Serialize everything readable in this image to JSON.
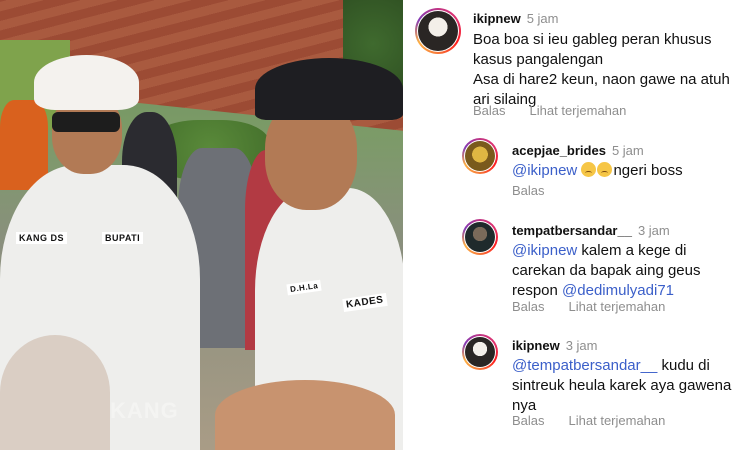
{
  "video": {
    "badges": {
      "left_tag": "KANG DS",
      "right_tag": "BUPATI",
      "kades": "KADES",
      "name_tag": "D.H.La"
    },
    "watermark": "KANG"
  },
  "comments": [
    {
      "username": "ikipnew",
      "time": "5 jam",
      "text_lines": [
        "Boa boa si ieu gableg peran khusus",
        "kasus pangalengan",
        "Asa di hare2 keun, naon gawe na atuh",
        "ari silaing"
      ],
      "actions": {
        "reply": "Balas",
        "translate": "Lihat terjemahan"
      },
      "avatar_icon": "profile-avatar"
    },
    {
      "username": "acepjae_brides",
      "time": "5 jam",
      "mention": "@ikipnew",
      "emoji_names": [
        "crying-face-emoji",
        "crying-face-emoji"
      ],
      "text": "ngeri boss",
      "actions": {
        "reply": "Balas"
      },
      "avatar_icon": "profile-avatar"
    },
    {
      "username": "tempatbersandar__",
      "time": "3 jam",
      "mention": "@ikipnew",
      "text_line1": " kalem a kege di",
      "text_line2": "carekan da bapak aing geus",
      "text_line3_prefix": "respon ",
      "mention2": "@dedimulyadi71",
      "actions": {
        "reply": "Balas",
        "translate": "Lihat terjemahan"
      },
      "avatar_icon": "profile-avatar"
    },
    {
      "username": "ikipnew",
      "time": "3 jam",
      "mention": "@tempatbersandar__",
      "text_line1": " kudu di",
      "text_line2": "sintreuk heula karek aya gawena",
      "text_line3": "nya",
      "actions": {
        "reply": "Balas",
        "translate": "Lihat terjemahan"
      },
      "avatar_icon": "profile-avatar"
    }
  ],
  "colors": {
    "mention": "#3b5fc9",
    "muted": "#8e8e8e",
    "text": "#111111"
  }
}
